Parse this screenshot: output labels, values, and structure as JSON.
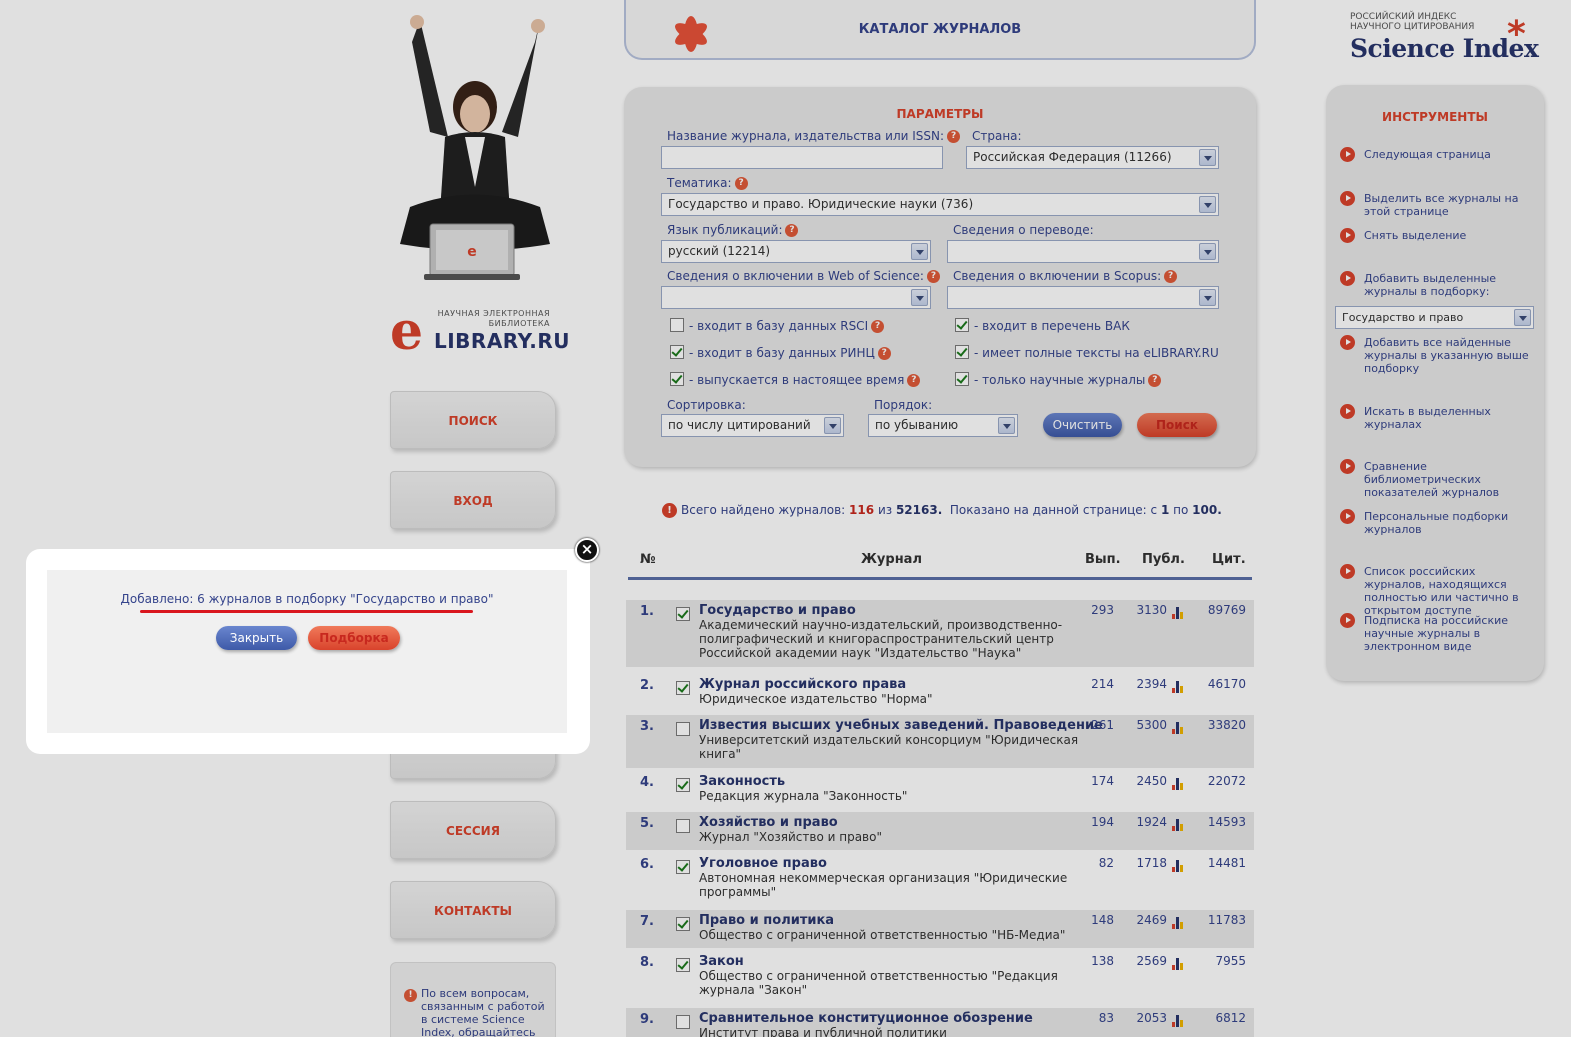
{
  "header": {
    "catalog_title": "КАТАЛОГ ЖУРНАЛОВ"
  },
  "logo": {
    "line1": "НАУЧНАЯ ЭЛЕКТРОННАЯ",
    "line2": "БИБЛИОТЕКА",
    "brand": "LIBRARY.RU"
  },
  "science_index": {
    "line1": "РОССИЙСКИЙ ИНДЕКС",
    "line2": "НАУЧНОГО ЦИТИРОВАНИЯ",
    "brand": "Science Index"
  },
  "nav": {
    "search": "ПОИСК",
    "login": "ВХОД",
    "session": "СЕССИЯ",
    "contacts": "КОНТАКТЫ"
  },
  "info_box": {
    "text": "По всем вопросам, связанным с работой в системе Science Index, обращайтесь"
  },
  "params": {
    "title": "ПАРАМЕТРЫ",
    "journal_label": "Название журнала, издательства или ISSN:",
    "journal_value": "",
    "country_label": "Страна:",
    "country_value": "Российская Федерация  (11266)",
    "topic_label": "Тематика:",
    "topic_value": "Государство и право. Юридические науки  (736)",
    "lang_label": "Язык публикаций:",
    "lang_value": "русский  (12214)",
    "translation_label": "Сведения о переводе:",
    "translation_value": "",
    "wos_label": "Сведения о включении в Web of Science:",
    "wos_value": "",
    "scopus_label": "Сведения о включении в Scopus:",
    "scopus_value": "",
    "cb_rsci": "- входит в базу данных RSCI",
    "cb_vak": "- входит в перечень ВАК",
    "cb_rinc": "- входит в базу данных РИНЦ",
    "cb_fulltext": "- имеет полные тексты на eLIBRARY.RU",
    "cb_current": "- выпускается в настоящее время",
    "cb_scientific": "- только научные журналы",
    "sort_label": "Сортировка:",
    "sort_value": "по числу цитирований",
    "order_label": "Порядок:",
    "order_value": "по убыванию",
    "clear_btn": "Очистить",
    "search_btn": "Поиск",
    "checks": {
      "rsci": false,
      "vak": true,
      "rinc": true,
      "fulltext": true,
      "current": true,
      "scientific": true
    }
  },
  "summary": {
    "prefix": "Всего найдено журналов:",
    "found": "116",
    "of": "из",
    "total": "52163.",
    "shown": "Показано на данной странице: с",
    "from": "1",
    "to_word": "по",
    "to": "100."
  },
  "table": {
    "headers": {
      "num": "№",
      "journal": "Журнал",
      "issues": "Вып.",
      "pubs": "Публ.",
      "cites": "Цит."
    },
    "rows": [
      {
        "num": "1.",
        "checked": true,
        "title": "Государство и право",
        "publisher": "Академический научно-издательский, производственно-полиграфический и книгораспространительский центр Российской академии наук \"Издательство \"Наука\"",
        "issues": "293",
        "pubs": "3130",
        "cites": "89769"
      },
      {
        "num": "2.",
        "checked": true,
        "title": "Журнал российского права",
        "publisher": "Юридическое издательство \"Норма\"",
        "issues": "214",
        "pubs": "2394",
        "cites": "46170"
      },
      {
        "num": "3.",
        "checked": false,
        "title": "Известия высших учебных заведений. Правоведение",
        "publisher": "Университетский издательский консорциум \"Юридическая книга\"",
        "issues": "261",
        "pubs": "5300",
        "cites": "33820"
      },
      {
        "num": "4.",
        "checked": true,
        "title": "Законность",
        "publisher": "Редакция журнала \"Законность\"",
        "issues": "174",
        "pubs": "2450",
        "cites": "22072"
      },
      {
        "num": "5.",
        "checked": false,
        "title": "Хозяйство и право",
        "publisher": "Журнал \"Хозяйство и право\"",
        "issues": "194",
        "pubs": "1924",
        "cites": "14593"
      },
      {
        "num": "6.",
        "checked": true,
        "title": "Уголовное право",
        "publisher": "Автономная некоммерческая организация \"Юридические программы\"",
        "issues": "82",
        "pubs": "1718",
        "cites": "14481"
      },
      {
        "num": "7.",
        "checked": true,
        "title": "Право и политика",
        "publisher": "Общество с ограниченной ответственностью \"НБ-Медиа\"",
        "issues": "148",
        "pubs": "2469",
        "cites": "11783"
      },
      {
        "num": "8.",
        "checked": true,
        "title": "Закон",
        "publisher": "Общество с ограниченной ответственностью \"Редакция журнала \"Закон\"",
        "issues": "138",
        "pubs": "2569",
        "cites": "7955"
      },
      {
        "num": "9.",
        "checked": false,
        "title": "Сравнительное конституционное обозрение",
        "publisher": "Институт права и публичной политики",
        "issues": "83",
        "pubs": "2053",
        "cites": "6812"
      }
    ]
  },
  "tools": {
    "title": "ИНСТРУМЕНТЫ",
    "next_page": "Следующая страница",
    "select_all": "Выделить все журналы на этой странице",
    "deselect": "Снять выделение",
    "add_selected": "Добавить выделенные журналы в подборку:",
    "collection_value": "Государство и право",
    "add_all": "Добавить все найденные журналы в указанную выше подборку",
    "search_selected": "Искать в выделенных журналах",
    "compare": "Сравнение библиометрических показателей журналов",
    "personal": "Персональные подборки журналов",
    "open_access": "Список российских журналов, находящихся полностью или частично в открытом доступе",
    "subscription": "Подписка на российские научные журналы в электронном виде"
  },
  "modal": {
    "message": "Добавлено: 6 журналов в подборку \"Государство и право\"",
    "close_btn": "Закрыть",
    "collection_btn": "Подборка",
    "close_icon": "×"
  },
  "colors": {
    "accent": "#d9432c",
    "navy": "#28356d",
    "link": "#35448c"
  }
}
